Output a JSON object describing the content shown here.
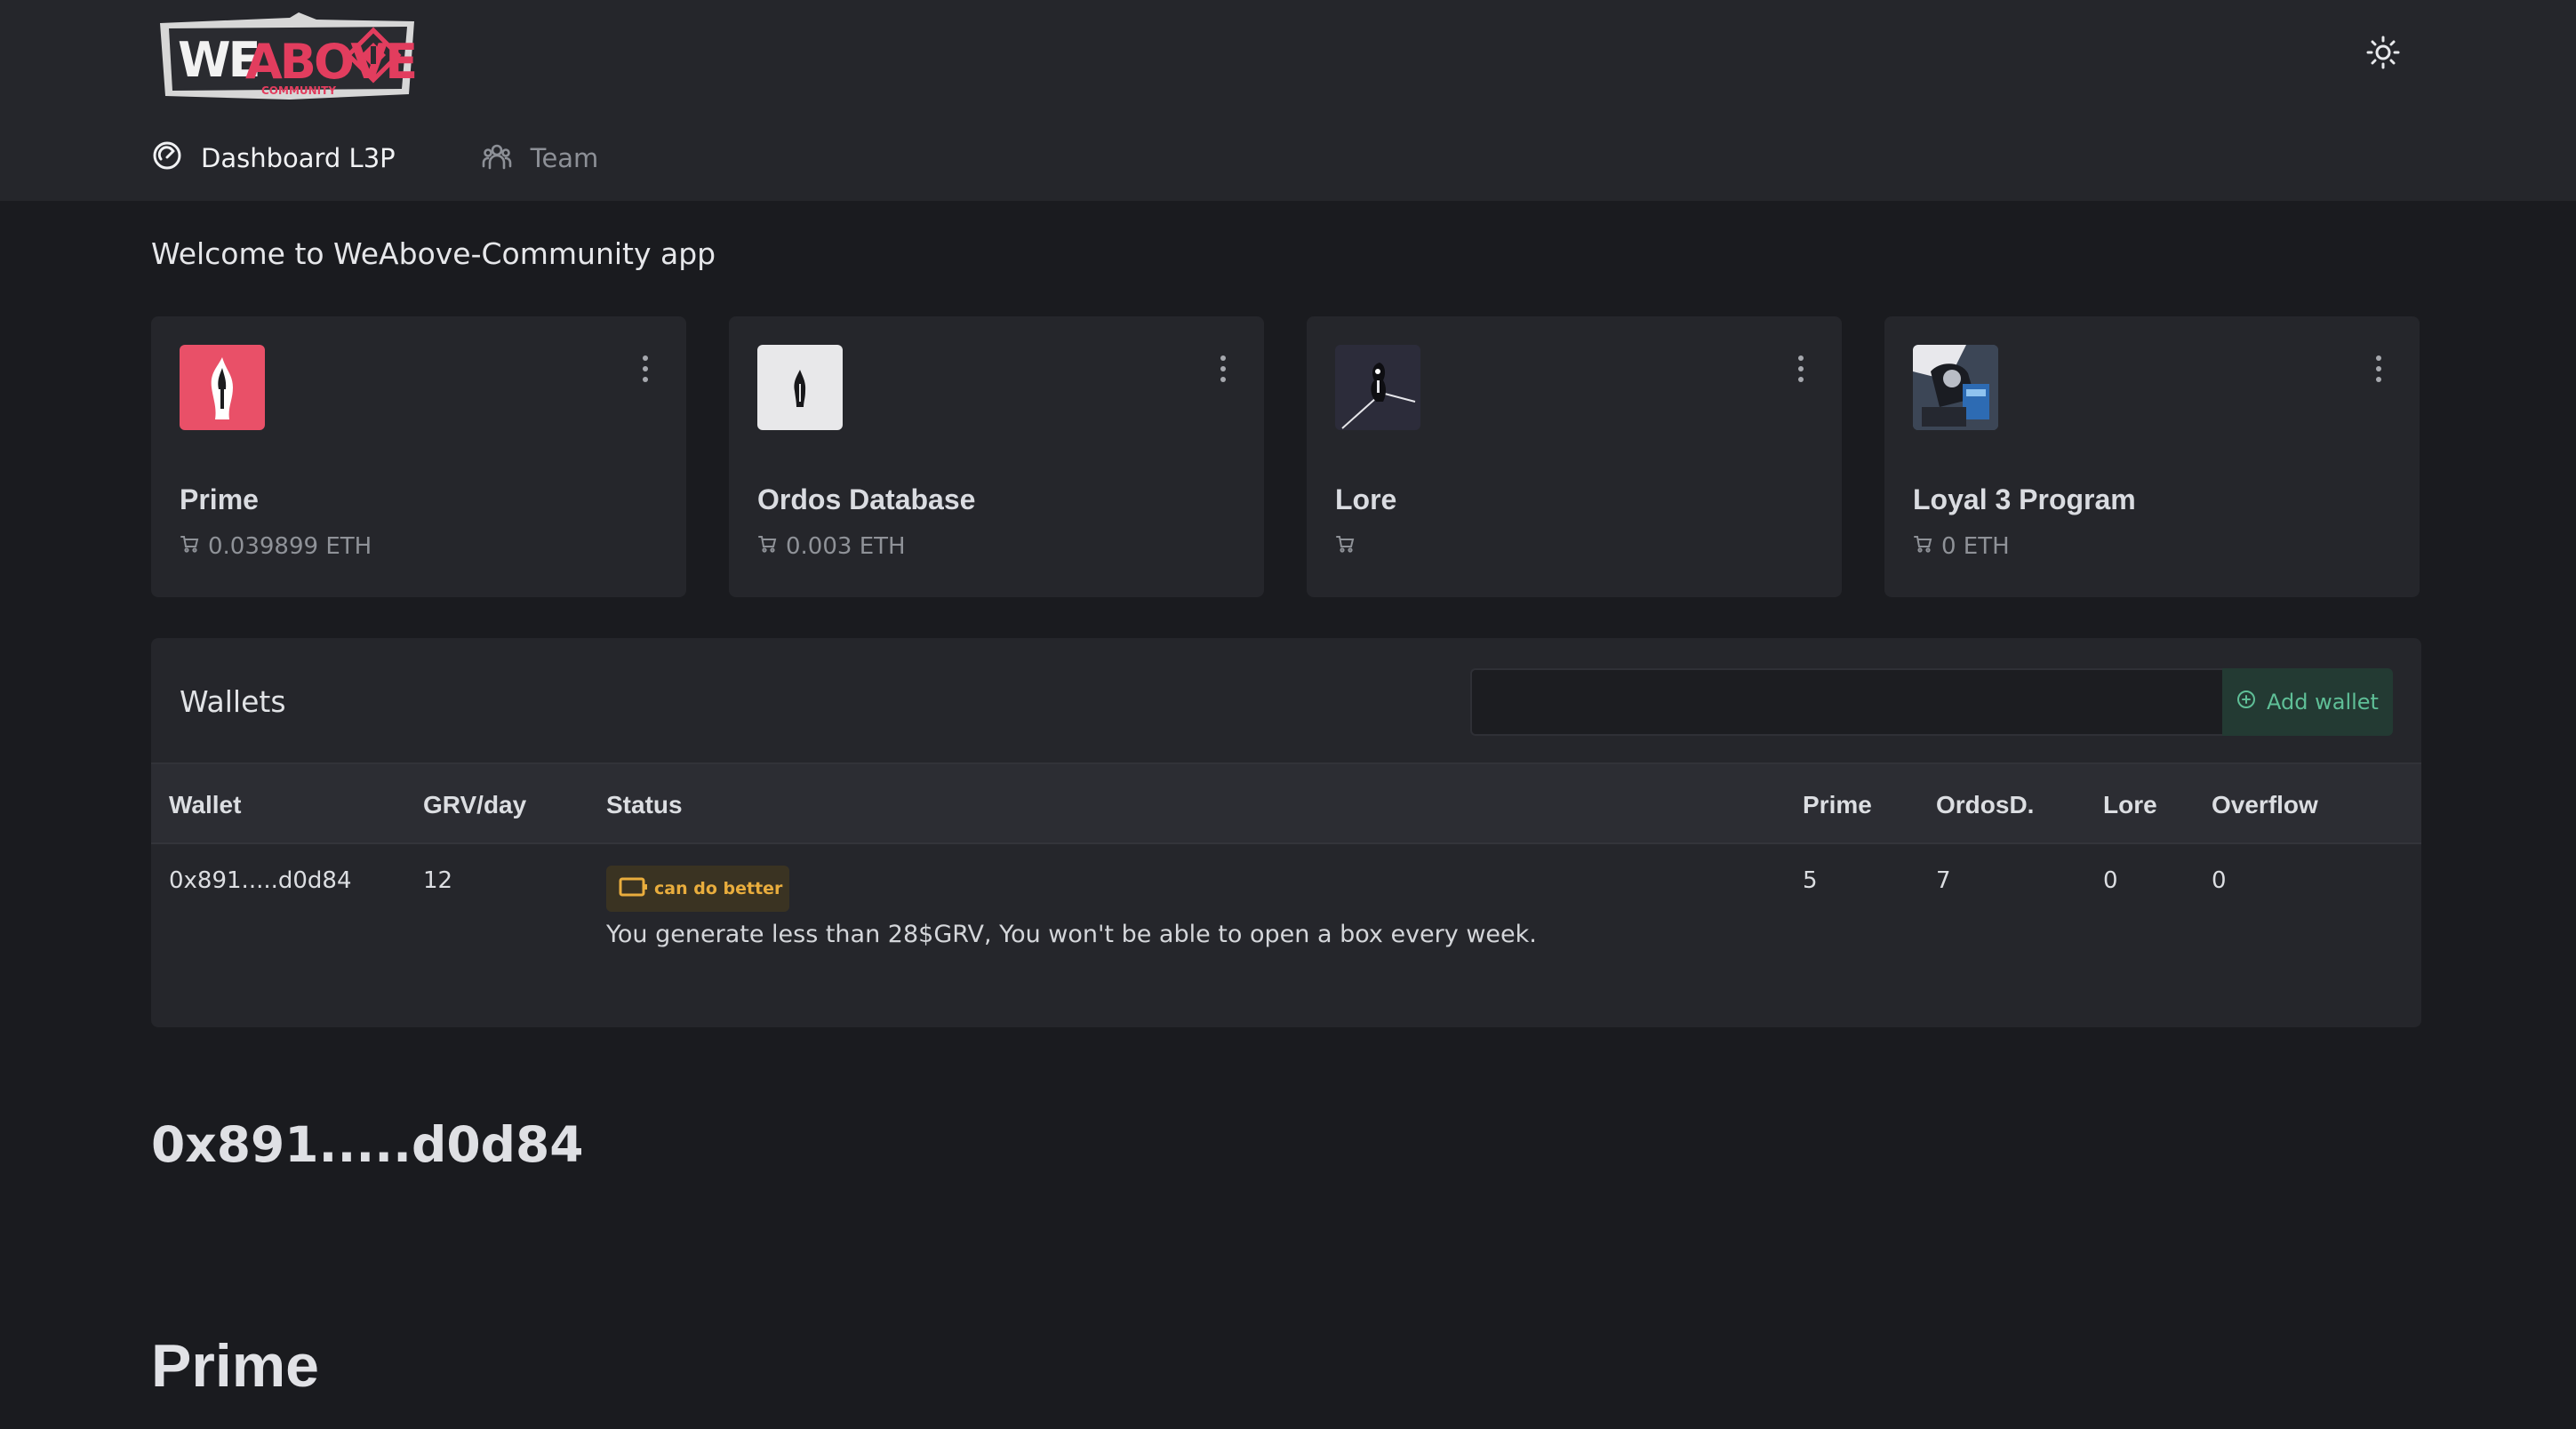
{
  "brand": {
    "logo_text": "WeAbove",
    "logo_subtext": "COMMUNITY",
    "logo_color": "#e23d5e"
  },
  "header": {
    "theme_icon": "sun-icon"
  },
  "nav": {
    "items": [
      {
        "label": "Dashboard L3P",
        "icon": "gauge-icon",
        "active": true
      },
      {
        "label": "Team",
        "icon": "users-icon",
        "active": false
      }
    ]
  },
  "welcome": "Welcome to WeAbove-Community app",
  "cards": [
    {
      "title": "Prime",
      "price": "0.039899 ETH",
      "thumb_bg": "#e95068"
    },
    {
      "title": "Ordos Database",
      "price": "0.003 ETH",
      "thumb_bg": "#e8e8ea"
    },
    {
      "title": "Lore",
      "price": "",
      "thumb_bg": "#2c2c3a"
    },
    {
      "title": "Loyal 3 Program",
      "price": "0 ETH",
      "thumb_bg": "#4a5566"
    }
  ],
  "wallets": {
    "title": "Wallets",
    "input_value": "",
    "add_label": "Add wallet",
    "columns": [
      "Wallet",
      "GRV/day",
      "Status",
      "Prime",
      "OrdosD.",
      "Lore",
      "Overflow"
    ],
    "rows": [
      {
        "wallet": "0x891.....d0d84",
        "grv_day": "12",
        "status_badge": "can do better",
        "status_message": "You generate less than 28$GRV, You won't be able to open a box every week.",
        "prime": "5",
        "ordosd": "7",
        "lore": "0",
        "overflow": "0"
      }
    ]
  },
  "address_heading": "0x891.....d0d84",
  "section_heading": "Prime",
  "colors": {
    "accent_green": "#5fbf97",
    "warning": "#e9ad3d",
    "background": "#1a1b1f",
    "panel": "#25262b"
  }
}
